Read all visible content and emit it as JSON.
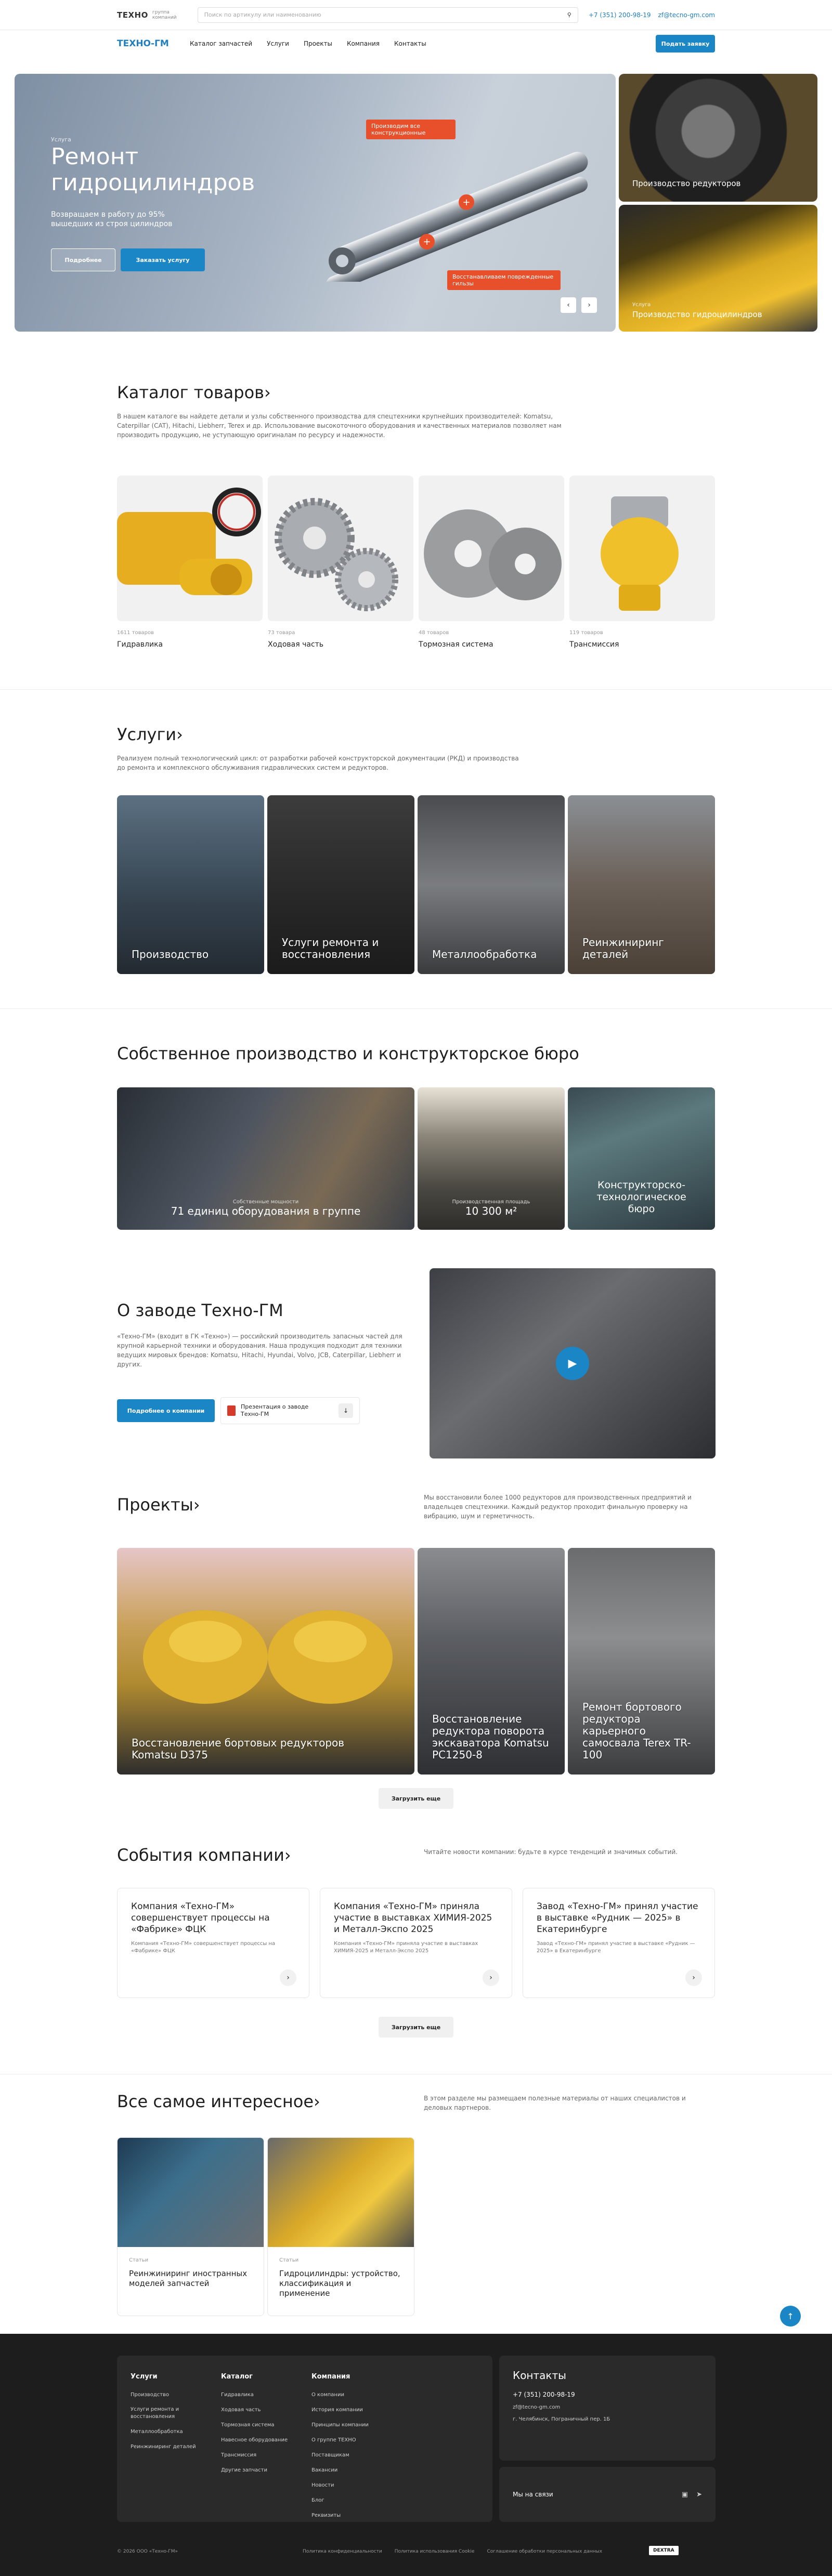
{
  "header": {
    "logo_text": "ТЕХНО",
    "logo_sub1": "группа",
    "logo_sub2": "компаний",
    "search_placeholder": "Поиск по артикулу или наименованию",
    "phone": "+7 (351) 200-98-19",
    "email": "zf@tecno-gm.com"
  },
  "nav": {
    "logo": "ТЕХНО-ГМ",
    "items": [
      "Каталог запчастей",
      "Услуги",
      "Проекты",
      "Компания",
      "Контакты"
    ],
    "cta": "Подать заявку"
  },
  "hero": {
    "eyebrow": "Услуга",
    "title": "Ремонт гидроцилиндров",
    "subtitle": "Возвращаем в работу до 95% вышедших из строя цилиндров",
    "btn_more": "Подробнее",
    "btn_order": "Заказать услугу",
    "pin1": "Производим все конструкционные",
    "pin2": "Восстанавливаем поврежденные гильзы",
    "side1_title": "Производство редукторов",
    "side2_eyebrow": "Услуга",
    "side2_title": "Производство гидроцилиндров"
  },
  "catalog": {
    "title": "Каталог товаров",
    "desc": "В нашем каталоге вы найдете детали и узлы собственного производства для спецтехники крупнейших производителей: Komatsu, Caterpillar (CAT), Hitachi, Liebherr, Terex и др. Использование высокоточного оборудования и качественных материалов позволяет нам производить продукцию, не уступающую оригиналам по ресурсу и надежности.",
    "items": [
      {
        "count": "1611 товаров",
        "name": "Гидравлика"
      },
      {
        "count": "73 товара",
        "name": "Ходовая часть"
      },
      {
        "count": "48 товаров",
        "name": "Тормозная система"
      },
      {
        "count": "119 товаров",
        "name": "Трансмиссия"
      }
    ]
  },
  "services": {
    "title": "Услуги",
    "desc": "Реализуем полный технологический цикл: от разработки рабочей конструкторской документации (РКД) и производства до ремонта и комплексного обслуживания гидравлических систем и редукторов.",
    "items": [
      "Производство",
      "Услуги ремонта и восстановления",
      "Металлообработка",
      "Реинжиниринг деталей"
    ]
  },
  "production": {
    "title": "Собственное производство и конструкторское бюро",
    "card1_sub": "Собственные мощности",
    "card1": "71 единиц оборудования в группе",
    "card2_sub": "Производственная площадь",
    "card2": "10 300 м²",
    "card3": "Конструкторско-технологическое бюро"
  },
  "about": {
    "title": "О заводе Техно-ГМ",
    "text": "«Техно-ГМ» (входит в ГК «Техно») — российский производитель запасных частей для крупной карьерной техники и оборудования. Наша продукция подходит для техники ведущих мировых брендов: Komatsu, Hitachi, Hyundai, Volvo, JCB, Caterpillar, Liebherr и других.",
    "btn": "Подробнее о компании",
    "doc": "Презентация о заводе Техно-ГМ"
  },
  "projects": {
    "title": "Проекты",
    "desc": "Мы восстановили более 1000 редукторов для производственных предприятий и владельцев спецтехники. Каждый редуктор проходит финальную проверку на вибрацию, шум и герметичность.",
    "items": [
      "Восстановление бортовых редукторов Komatsu D375",
      "Восстановление редуктора поворота экскаватора Komatsu PC1250-8",
      "Ремонт бортового редуктора карьерного самосвала Terex TR-100"
    ],
    "load_more": "Загрузить еще"
  },
  "events": {
    "title": "События компании",
    "desc": "Читайте новости компании: будьте в курсе тенденций и значимых событий.",
    "items": [
      {
        "title": "Компания «Техно-ГМ» совершенствует процессы на «Фабрике» ФЦК",
        "text": "Компания «Техно-ГМ» совершенствует процессы на «Фабрике» ФЦК"
      },
      {
        "title": "Компания «Техно-ГМ» приняла участие в выставках ХИМИЯ-2025 и Металл-Экспо 2025",
        "text": "Компания «Техно-ГМ» приняла участие в выставках ХИМИЯ-2025 и Металл-Экспо 2025"
      },
      {
        "title": "Завод «Техно-ГМ» принял участие в выставке «Рудник — 2025» в Екатеринбурге",
        "text": "Завод «Техно-ГМ» принял участие в выставке «Рудник — 2025» в Екатеринбурге"
      }
    ],
    "load_more": "Загрузить еще"
  },
  "interesting": {
    "title": "Все самое интересное",
    "desc": "В этом разделе мы размещаем полезные материалы от наших специалистов и деловых партнеров.",
    "items": [
      {
        "tag": "Статьи",
        "title": "Реинжиниринг иностранных моделей запчастей"
      },
      {
        "tag": "Статьи",
        "title": "Гидроцилиндры: устройство, классификация и применение"
      }
    ]
  },
  "footer": {
    "col1_title": "Услуги",
    "col1": [
      "Производство",
      "Услуги ремонта и восстановления",
      "Металлообработка",
      "Реинжиниринг деталей"
    ],
    "col2_title": "Каталог",
    "col2": [
      "Гидравлика",
      "Ходовая часть",
      "Тормозная система",
      "Навесное оборудование",
      "Трансмиссия",
      "Другие запчасти"
    ],
    "col3_title": "Компания",
    "col3": [
      "О компании",
      "История компании",
      "Принципы компании",
      "О группе ТЕХНО",
      "Поставщикам",
      "Вакансии",
      "Новости",
      "Блог",
      "Реквизиты"
    ],
    "contacts_title": "Контакты",
    "phone": "+7 (351) 200-98-19",
    "email": "zf@tecno-gm.com",
    "address": "г. Челябинск, Пограничный пер. 1Б",
    "social": "Мы на связи",
    "copyright": "© 2026 ООО «Техно-ГМ»",
    "links": [
      "Политика конфиденциальности",
      "Политика использования Cookie",
      "Соглашение обработки персональных данных"
    ],
    "dev": "DEXTRA"
  }
}
